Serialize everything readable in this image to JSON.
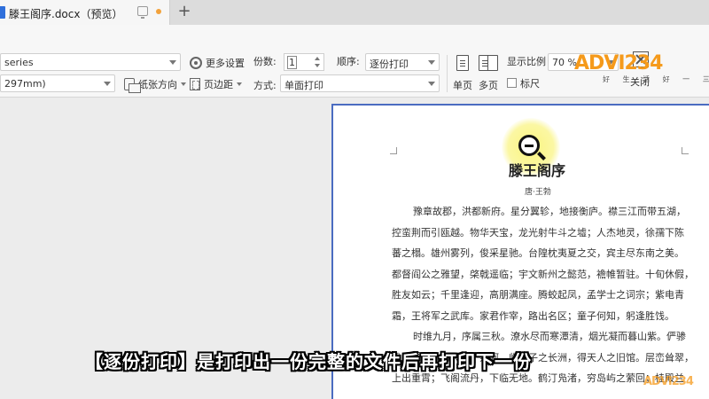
{
  "tab": {
    "title": "滕王阁序.docx（预览）",
    "new_tab_symbol": "+"
  },
  "toolbar": {
    "printer_value": "series",
    "paper_value": "297mm)",
    "more_settings": "更多设置",
    "orientation": "纸张方向",
    "margins": "页边距",
    "copies_label": "份数:",
    "copies_value": "1",
    "order_label": "顺序:",
    "order_value": "逐份打印",
    "mode_label": "方式:",
    "mode_value": "单面打印",
    "single_page": "单页",
    "multi_page": "多页",
    "zoom_label": "显示比例",
    "zoom_value": "70 %",
    "ruler": "标尺",
    "close": "关闭"
  },
  "watermark": {
    "logo": "ADVI234",
    "sub": "好 生 活 好 一 三 四"
  },
  "document": {
    "title": "滕王阁序",
    "author": "唐·王勃",
    "lines": [
      {
        "text": "豫章故郡，洪都新府。星分翼轸，地接衡庐。襟三江而带五湖，",
        "indent": true
      },
      {
        "text": "控蛮荆而引瓯越。物华天宝，龙光射牛斗之墟；人杰地灵，徐孺下陈",
        "indent": false
      },
      {
        "text": "蕃之榻。雄州雾列，俊采星驰。台隍枕夷夏之交，宾主尽东南之美。",
        "indent": false
      },
      {
        "text": "都督阎公之雅望，棨戟遥临；宇文新州之懿范，襜帷暂驻。十旬休假，",
        "indent": false
      },
      {
        "text": "胜友如云；千里逢迎，高朋满座。腾蛟起凤，孟学士之词宗；紫电青",
        "indent": false
      },
      {
        "text": "霜，王将军之武库。家君作宰，路出名区；童子何知，躬逢胜饯。",
        "indent": false
      },
      {
        "text": "时维九月，序属三秋。潦水尽而寒潭清，烟光凝而暮山紫。俨骖",
        "indent": true
      },
      {
        "text": "骓于上路，访风景于崇阿。临帝子之长洲，得天人之旧馆。层峦耸翠，",
        "indent": false
      },
      {
        "text": "上出重霄；飞阁流丹，下临无地。鹤汀凫渚，穷岛屿之萦回；桂殿兰",
        "indent": false
      }
    ]
  },
  "subtitle": "【逐份打印】是打印出一份完整的文件后再打印下一份",
  "colors": {
    "page_border": "#4b6cc1",
    "tab_dot": "#f2a23b",
    "logo_orange": "#f59a1b",
    "logo_green": "#7bc043",
    "highlight": "#faf578"
  }
}
